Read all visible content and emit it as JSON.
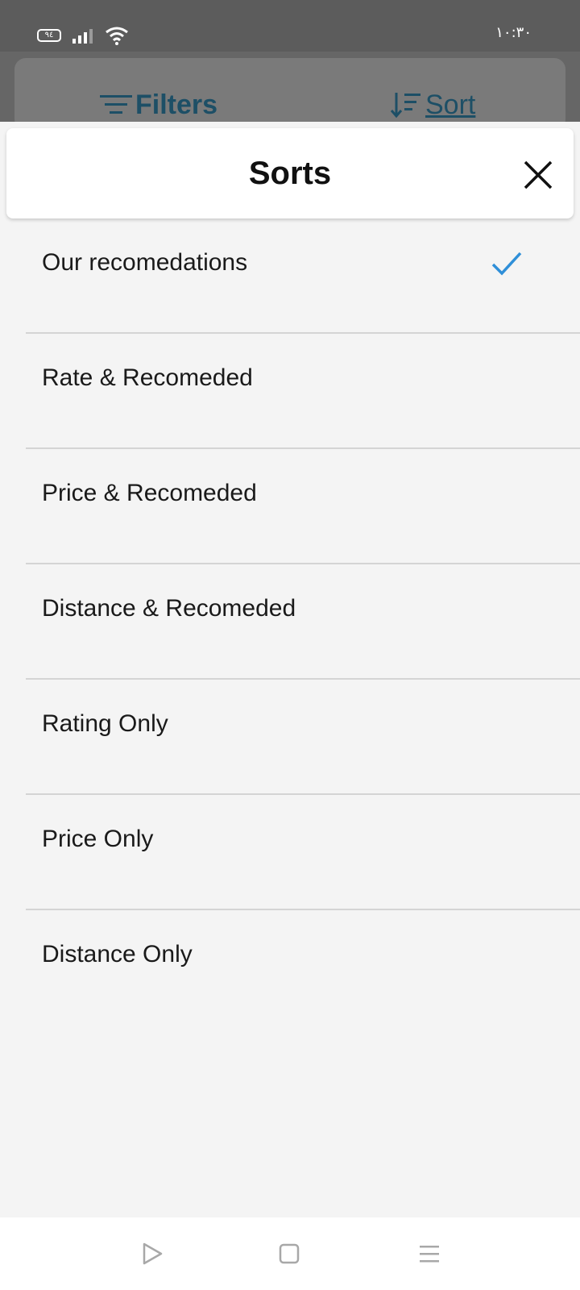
{
  "status_bar": {
    "battery_level": "٩٤",
    "time": "١٠:٣٠",
    "icons": [
      "battery-icon",
      "signal-icon",
      "wifi-icon"
    ]
  },
  "toolbar": {
    "filters_label": "Filters",
    "sort_label": "Sort",
    "filters_icon": "filter-lines-icon",
    "sort_icon": "sort-descending-icon",
    "color": "#1d4f66"
  },
  "sheet": {
    "title": "Sorts",
    "close_icon": "close-icon",
    "options": [
      {
        "label": "Our recomedations",
        "selected": true
      },
      {
        "label": "Rate & Recomeded",
        "selected": false
      },
      {
        "label": "Price & Recomeded",
        "selected": false
      },
      {
        "label": "Distance & Recomeded",
        "selected": false
      },
      {
        "label": "Rating Only",
        "selected": false
      },
      {
        "label": "Price Only",
        "selected": false
      },
      {
        "label": "Distance Only",
        "selected": false
      }
    ],
    "check_color": "#2f8fd8"
  },
  "nav_bar": {
    "icons": [
      "back-triangle-icon",
      "home-square-icon",
      "menu-lines-icon"
    ]
  }
}
